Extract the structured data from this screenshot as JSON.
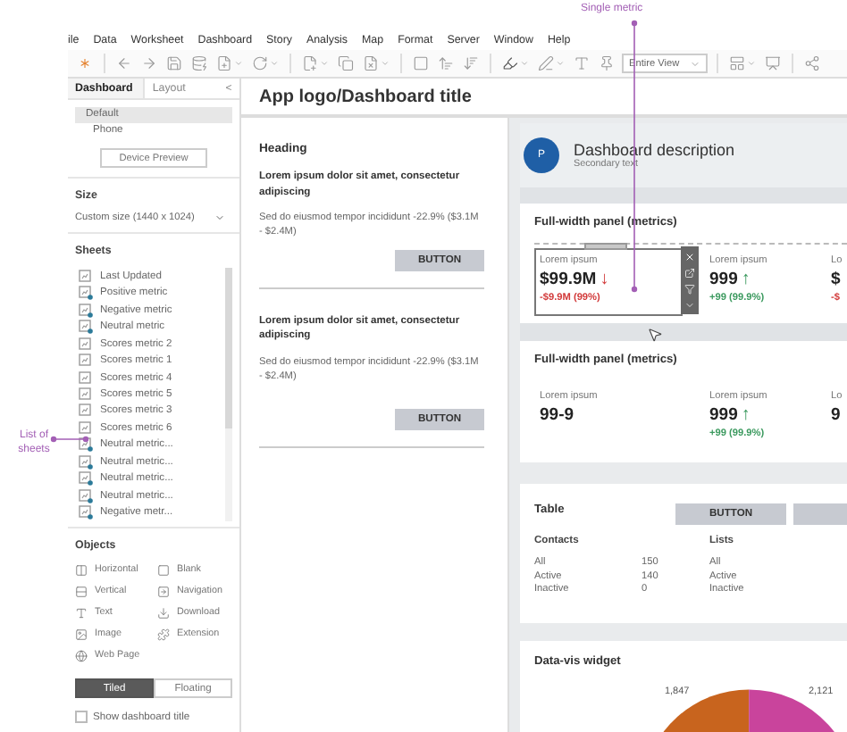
{
  "callouts": {
    "top": "Single metric",
    "left": "List of sheets"
  },
  "menu": [
    "ile",
    "Data",
    "Worksheet",
    "Dashboard",
    "Story",
    "Analysis",
    "Map",
    "Format",
    "Server",
    "Window",
    "Help"
  ],
  "toolbar": {
    "view_fit": "Entire View"
  },
  "left_panel": {
    "tabs": [
      {
        "label": "Dashboard",
        "selected": true
      },
      {
        "label": "Layout",
        "selected": false
      }
    ],
    "collapse": "<",
    "devices": [
      {
        "label": "Default",
        "selected": true
      },
      {
        "label": "Phone",
        "selected": false
      }
    ],
    "device_preview": "Device Preview",
    "size": {
      "heading": "Size",
      "value": "Custom size (1440 x 1024)"
    },
    "sheets": {
      "heading": "Sheets",
      "items": [
        {
          "name": "Last Updated",
          "in_dashboard": false
        },
        {
          "name": "Positive metric",
          "in_dashboard": true
        },
        {
          "name": "Negative metric",
          "in_dashboard": true
        },
        {
          "name": "Neutral metric",
          "in_dashboard": true
        },
        {
          "name": "Scores metric 2",
          "in_dashboard": false
        },
        {
          "name": "Scores metric 1",
          "in_dashboard": false
        },
        {
          "name": "Scores metric 4",
          "in_dashboard": false
        },
        {
          "name": "Scores metric 5",
          "in_dashboard": false
        },
        {
          "name": "Scores metric 3",
          "in_dashboard": false
        },
        {
          "name": "Scores metric 6",
          "in_dashboard": false
        },
        {
          "name": "Neutral metric...",
          "in_dashboard": true
        },
        {
          "name": "Neutral metric...",
          "in_dashboard": true
        },
        {
          "name": "Neutral metric...",
          "in_dashboard": true
        },
        {
          "name": "Neutral metric...",
          "in_dashboard": true
        },
        {
          "name": "Negative metr...",
          "in_dashboard": true
        }
      ]
    },
    "objects": {
      "heading": "Objects",
      "items": [
        {
          "label": "Horizontal",
          "kind": "horizontal"
        },
        {
          "label": "Blank",
          "kind": "blank"
        },
        {
          "label": "Vertical",
          "kind": "vertical"
        },
        {
          "label": "Navigation",
          "kind": "navigation"
        },
        {
          "label": "Text",
          "kind": "text"
        },
        {
          "label": "Download",
          "kind": "download"
        },
        {
          "label": "Image",
          "kind": "image"
        },
        {
          "label": "Extension",
          "kind": "extension"
        },
        {
          "label": "Web Page",
          "kind": "web"
        }
      ]
    },
    "layout_mode": [
      {
        "label": "Tiled",
        "selected": true
      },
      {
        "label": "Floating",
        "selected": false
      }
    ],
    "show_title": {
      "label": "Show dashboard title",
      "checked": false
    }
  },
  "canvas": {
    "title": "App logo/Dashboard title",
    "side_column": {
      "heading": "Heading",
      "items": [
        {
          "title": "Lorem ipsum dolor sit amet, consectetur adipiscing",
          "body": "Sed do eiusmod tempor incididunt -22.9% ($3.1M - $2.4M)",
          "button": "BUTTON"
        },
        {
          "title": "Lorem ipsum dolor sit amet, consectetur adipiscing",
          "body": "Sed do eiusmod tempor incididunt -22.9% ($3.1M - $2.4M)",
          "button": "BUTTON"
        }
      ]
    },
    "description": {
      "avatar": "P",
      "title": "Dashboard description",
      "subtitle": "Secondary text"
    },
    "panels": [
      {
        "title": "Full-width panel (metrics)",
        "metrics": [
          {
            "label": "Lorem ipsum",
            "value": "$99.9M",
            "arrow": "↓",
            "change": "-$9.9M (99%)",
            "color": "#d23a3a",
            "selected": true
          },
          {
            "label": "Lorem ipsum",
            "value": "999",
            "arrow": "↑",
            "change": "+99 (99.9%)",
            "color": "#3c9a5f",
            "selected": false
          },
          {
            "label": "Lo",
            "value": "$",
            "change": "-$",
            "color": "#d23a3a",
            "selected": false
          }
        ]
      },
      {
        "title": "Full-width panel (metrics)",
        "metrics": [
          {
            "label": "Lorem ipsum",
            "value": "99-9",
            "selected": false
          },
          {
            "label": "Lorem ipsum",
            "value": "999",
            "arrow": "↑",
            "change": "+99 (99.9%)",
            "color": "#3c9a5f",
            "selected": false
          },
          {
            "label": "Lo",
            "value": "9",
            "selected": false
          }
        ]
      }
    ],
    "table": {
      "title": "Table",
      "button": "BUTTON",
      "groups": [
        {
          "heading": "Contacts",
          "rows": [
            {
              "label": "All",
              "value": "150"
            },
            {
              "label": "Active",
              "value": "140"
            },
            {
              "label": "Inactive",
              "value": "0"
            }
          ]
        },
        {
          "heading": "Lists",
          "rows": [
            {
              "label": "All"
            },
            {
              "label": "Active"
            },
            {
              "label": "Inactive"
            }
          ]
        }
      ]
    },
    "widget": {
      "title": "Data-vis widget",
      "chart_data": {
        "type": "pie",
        "values": [
          1847,
          2121
        ],
        "value_labels": [
          "1,847",
          "2,121"
        ]
      }
    }
  }
}
